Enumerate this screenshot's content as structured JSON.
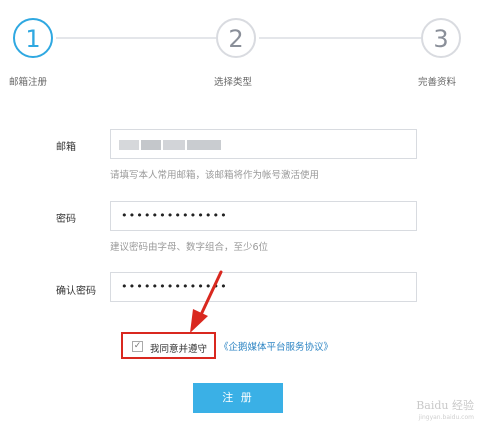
{
  "steps": [
    {
      "number": "1",
      "label": "邮箱注册"
    },
    {
      "number": "2",
      "label": "选择类型"
    },
    {
      "number": "3",
      "label": "完善资料"
    }
  ],
  "form": {
    "email": {
      "label": "邮箱",
      "hint": "请填写本人常用邮箱，该邮箱将作为帐号激活使用"
    },
    "password": {
      "label": "密码",
      "value": "••••••••••••••",
      "hint": "建议密码由字母、数字组合，至少6位"
    },
    "confirm": {
      "label": "确认密码",
      "value": "••••••••••••••"
    }
  },
  "agreement": {
    "checkbox_mark": "✓",
    "text": "我同意并遵守",
    "link": "《企鹅媒体平台服务协议》"
  },
  "submit_label": "注 册",
  "watermark": {
    "main": "Baidu 经验",
    "sub": "jingyan.baidu.com"
  },
  "colors": {
    "accent": "#2fa8e1",
    "button": "#3ab0e6",
    "highlight": "#d9281f"
  }
}
